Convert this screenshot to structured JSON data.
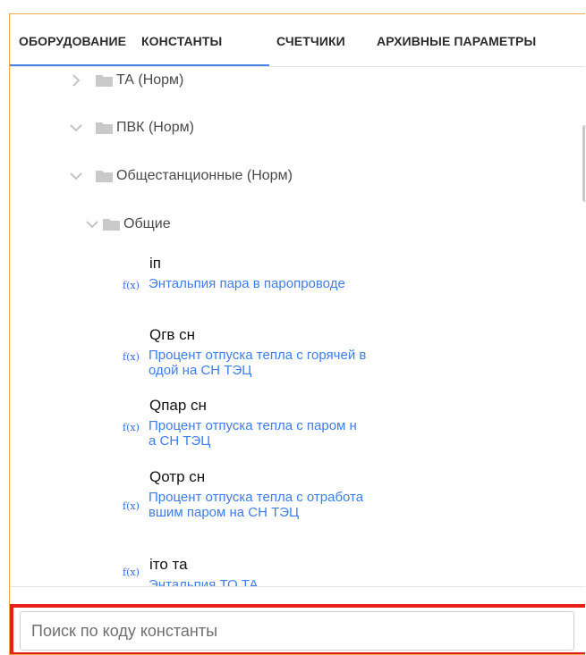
{
  "tabs": [
    {
      "label": "ОБОРУДОВАНИЕ"
    },
    {
      "label": "КОНСТАНТЫ",
      "active": true
    },
    {
      "label": "СЧЕТЧИКИ"
    },
    {
      "label": "АРХИВНЫЕ ПАРАМЕТРЫ"
    }
  ],
  "tree": [
    {
      "label": "ТА (Норм)",
      "expanded": false
    },
    {
      "label": "ПВК (Норм)",
      "expanded": true
    },
    {
      "label": "Общестанционные (Норм)",
      "expanded": true
    },
    {
      "label": "Общие",
      "expanded": true
    }
  ],
  "fx_label": "f(x)",
  "constants": [
    {
      "code": "iп",
      "desc": "Энтальпия пара в паропроводе"
    },
    {
      "code": "Qгв сн",
      "desc": "Процент отпуска тепла с горячей водой на СН ТЭЦ"
    },
    {
      "code": "Qпар сн",
      "desc": "Процент отпуска тепла с паром на СН ТЭЦ"
    },
    {
      "code": "Qотр сн",
      "desc": "Процент отпуска тепла с отработавшим паром на СН ТЭЦ"
    },
    {
      "code": "iто та",
      "desc": "Энтальпия ТО ТА"
    }
  ],
  "search": {
    "placeholder": "Поиск по коду константы",
    "value": ""
  },
  "colors": {
    "accent": "#4a86e8",
    "link": "#3f7de8",
    "highlight_border": "#e8201a",
    "panel_border": "#f0a64a",
    "folder": "#c9c9c9",
    "chevron": "#c4c4c4"
  },
  "icons": {
    "folder": "folder-icon",
    "chevron_right": "chevron-right-icon",
    "chevron_down": "chevron-down-icon",
    "function": "function-icon"
  }
}
